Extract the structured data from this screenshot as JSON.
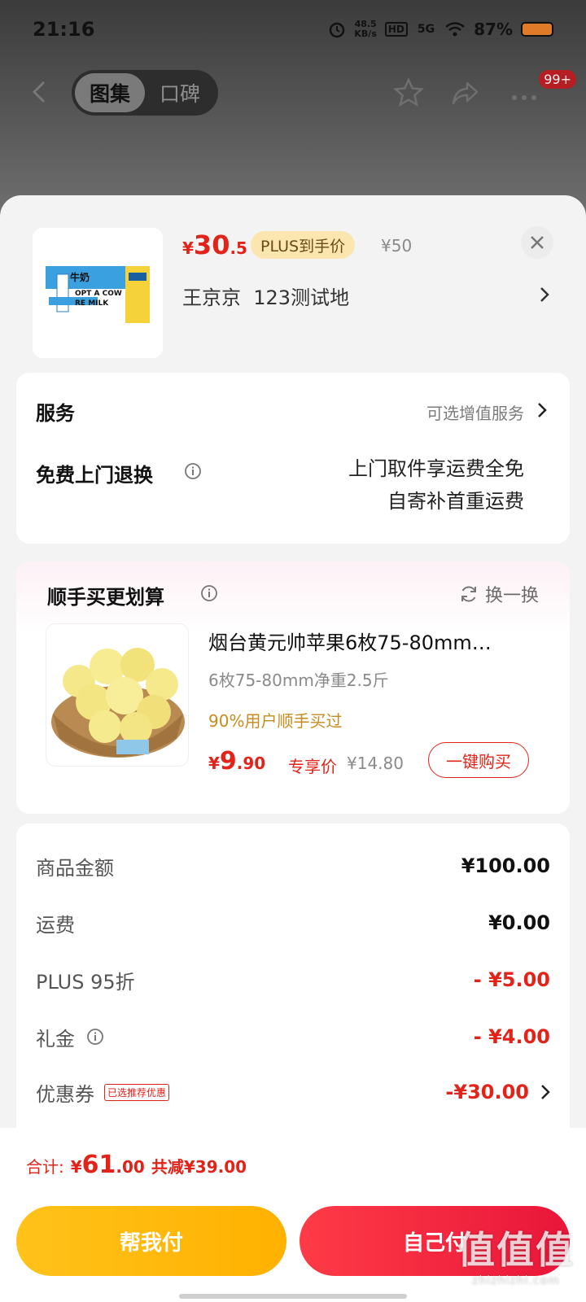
{
  "status_bar": {
    "time": "21:16",
    "net_speed_value": "48.5",
    "net_speed_unit": "KB/s",
    "hd": "HD",
    "signal": "5G",
    "battery": "87%"
  },
  "nav": {
    "tabs": [
      "图集",
      "口碑"
    ],
    "active_tab": 0,
    "badge": "99+"
  },
  "product": {
    "price_currency": "¥",
    "price_int": "30",
    "price_dec": ".5",
    "plus_tag": "PLUS到手价",
    "original_price": "¥50",
    "address_name": "王京京",
    "address_text": "123测试地",
    "thumb_texts": [
      "牛奶",
      "OPT A COW",
      "RE MILK"
    ]
  },
  "service": {
    "title": "服务",
    "subtitle": "可选增值服务",
    "return_title": "免费上门退换",
    "return_line1": "上门取件享运费全免",
    "return_line2": "自寄补首重运费"
  },
  "bundle": {
    "title": "顺手买更划算",
    "swap_label": "换一换",
    "item_name": "烟台黄元帅苹果6枚75-80mm…",
    "item_spec": "6枚75-80mm净重2.5斤",
    "item_bought": "90%用户顺手买过",
    "price_currency": "¥",
    "price_int": "9",
    "price_dec": ".90",
    "price_tag": "专享价",
    "original_price": "¥14.80",
    "buy_label": "一键购买"
  },
  "summary": {
    "rows": [
      {
        "label": "商品金额",
        "value": "¥100.00"
      },
      {
        "label": "运费",
        "value": "¥0.00"
      },
      {
        "label": "PLUS 95折",
        "value": "- ¥5.00"
      },
      {
        "label": "礼金",
        "value": "- ¥4.00"
      },
      {
        "label": "优惠券",
        "value": "-¥30.00",
        "chip": "已选推荐优惠"
      }
    ]
  },
  "footer": {
    "total_label": "合计:",
    "total_currency": "¥",
    "total_int": "61",
    "total_dec": ".00",
    "total_off": "共减¥39.00",
    "help_pay": "帮我付",
    "self_pay": "自己付"
  },
  "watermark": {
    "big": "值值值",
    "small": "zhizhizhi.com"
  },
  "colors": {
    "accent_red": "#e2231a",
    "plus_gold": "#fbe6b0",
    "help_yellow": "#ffb100"
  }
}
